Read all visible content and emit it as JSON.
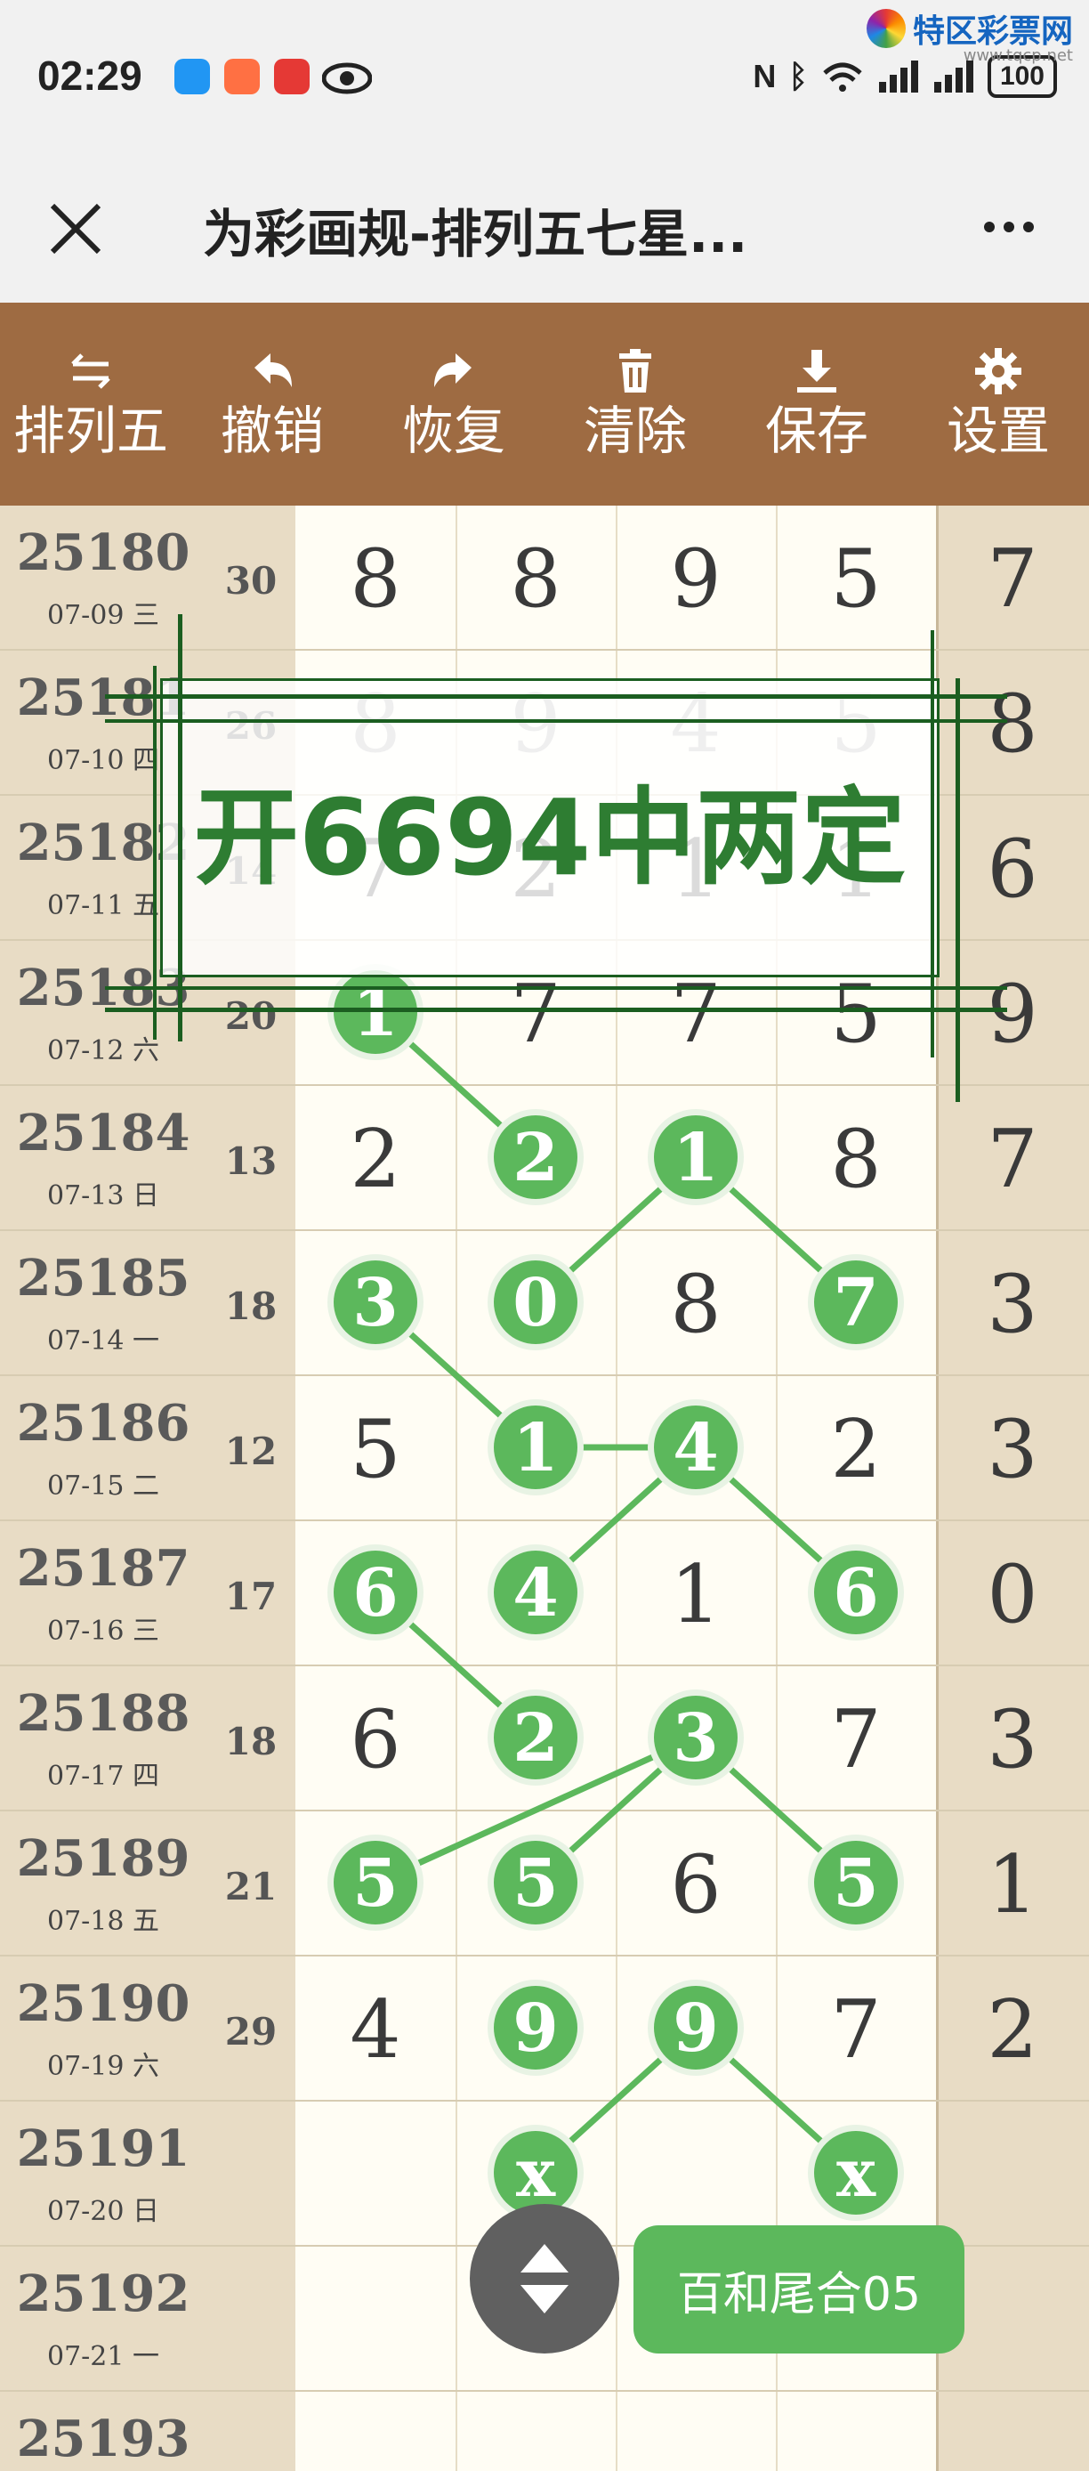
{
  "status_bar": {
    "time": "02:29",
    "battery": "100",
    "watermark_text": "特区彩票网",
    "watermark_url": "www.tqcp.net"
  },
  "title_bar": {
    "title": "为彩画规-排列五七星..."
  },
  "toolbar": {
    "items": [
      {
        "icon": "swap-icon",
        "label": "排列五"
      },
      {
        "icon": "undo-icon",
        "label": "撤销"
      },
      {
        "icon": "redo-icon",
        "label": "恢复"
      },
      {
        "icon": "trash-icon",
        "label": "清除"
      },
      {
        "icon": "download-icon",
        "label": "保存"
      },
      {
        "icon": "gear-icon",
        "label": "设置"
      }
    ]
  },
  "rows": [
    {
      "issue": "25180",
      "date": "07-09 三",
      "sum": "30",
      "digits": [
        "8",
        "8",
        "9",
        "5"
      ],
      "fifth": "7"
    },
    {
      "issue": "25181",
      "date": "07-10 四",
      "sum": "26",
      "digits": [
        "8",
        "9",
        "4",
        "5"
      ],
      "fifth": "8"
    },
    {
      "issue": "25182",
      "date": "07-11 五",
      "sum": "14",
      "digits": [
        "7",
        "2",
        "1",
        "1"
      ],
      "fifth": "6"
    },
    {
      "issue": "25183",
      "date": "07-12 六",
      "sum": "20",
      "digits": [
        "1",
        "7",
        "7",
        "5"
      ],
      "fifth": "9"
    },
    {
      "issue": "25184",
      "date": "07-13 日",
      "sum": "13",
      "digits": [
        "2",
        "2",
        "1",
        "8"
      ],
      "fifth": "7"
    },
    {
      "issue": "25185",
      "date": "07-14 一",
      "sum": "18",
      "digits": [
        "3",
        "0",
        "8",
        "7"
      ],
      "fifth": "3"
    },
    {
      "issue": "25186",
      "date": "07-15 二",
      "sum": "12",
      "digits": [
        "5",
        "1",
        "4",
        "2"
      ],
      "fifth": "3"
    },
    {
      "issue": "25187",
      "date": "07-16 三",
      "sum": "17",
      "digits": [
        "6",
        "4",
        "1",
        "6"
      ],
      "fifth": "0"
    },
    {
      "issue": "25188",
      "date": "07-17 四",
      "sum": "18",
      "digits": [
        "6",
        "2",
        "3",
        "7"
      ],
      "fifth": "3"
    },
    {
      "issue": "25189",
      "date": "07-18 五",
      "sum": "21",
      "digits": [
        "5",
        "5",
        "6",
        "5"
      ],
      "fifth": "1"
    },
    {
      "issue": "25190",
      "date": "07-19 六",
      "sum": "29",
      "digits": [
        "4",
        "9",
        "9",
        "7"
      ],
      "fifth": "2"
    },
    {
      "issue": "25191",
      "date": "07-20 日",
      "sum": "",
      "digits": [
        "",
        "x",
        "",
        "x"
      ],
      "fifth": ""
    },
    {
      "issue": "25192",
      "date": "07-21 一",
      "sum": "",
      "digits": [
        "",
        "",
        "",
        ""
      ],
      "fifth": ""
    },
    {
      "issue": "25193",
      "date": "",
      "sum": "",
      "digits": [
        "",
        "",
        "",
        ""
      ],
      "fifth": ""
    }
  ],
  "balls": [
    {
      "row": 3,
      "col": 0,
      "label": "1"
    },
    {
      "row": 4,
      "col": 1,
      "label": "2"
    },
    {
      "row": 4,
      "col": 2,
      "label": "1"
    },
    {
      "row": 5,
      "col": 0,
      "label": "3"
    },
    {
      "row": 5,
      "col": 1,
      "label": "0"
    },
    {
      "row": 5,
      "col": 3,
      "label": "7"
    },
    {
      "row": 6,
      "col": 1,
      "label": "1"
    },
    {
      "row": 6,
      "col": 2,
      "label": "4"
    },
    {
      "row": 7,
      "col": 0,
      "label": "6"
    },
    {
      "row": 7,
      "col": 1,
      "label": "4"
    },
    {
      "row": 7,
      "col": 3,
      "label": "6"
    },
    {
      "row": 8,
      "col": 1,
      "label": "2"
    },
    {
      "row": 8,
      "col": 2,
      "label": "3"
    },
    {
      "row": 9,
      "col": 0,
      "label": "5"
    },
    {
      "row": 9,
      "col": 1,
      "label": "5"
    },
    {
      "row": 9,
      "col": 3,
      "label": "5"
    },
    {
      "row": 10,
      "col": 1,
      "label": "9"
    },
    {
      "row": 10,
      "col": 2,
      "label": "9"
    },
    {
      "row": 11,
      "col": 1,
      "label": "x"
    },
    {
      "row": 11,
      "col": 3,
      "label": "x"
    }
  ],
  "links": [
    [
      0,
      1
    ],
    [
      3,
      6
    ],
    [
      6,
      7
    ],
    [
      8,
      11
    ],
    [
      12,
      13
    ],
    [
      4,
      2
    ],
    [
      2,
      5
    ],
    [
      9,
      7
    ],
    [
      7,
      10
    ],
    [
      14,
      12
    ],
    [
      12,
      15
    ],
    [
      19,
      17
    ],
    [
      17,
      18
    ]
  ],
  "note": {
    "text": "开6694中两定"
  },
  "badge": {
    "text": "百和尾合05"
  },
  "colors": {
    "toolbar": "#9e6b42",
    "ball": "#5cb85c",
    "note": "#2e7d32"
  }
}
